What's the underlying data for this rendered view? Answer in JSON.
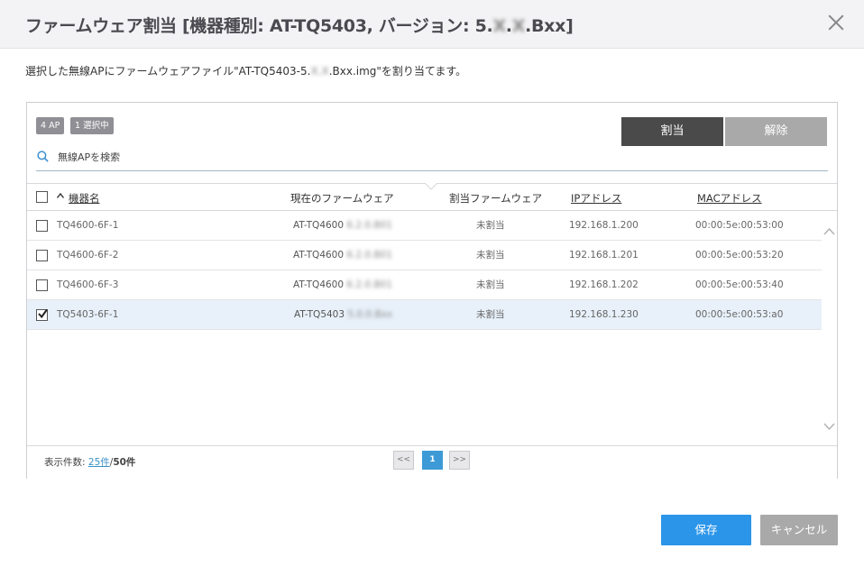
{
  "dialog": {
    "title_prefix": "ファームウェア割当 [機器種別: AT-TQ5403, バージョン: 5.",
    "title_blur1": "X",
    "title_dot": ".",
    "title_blur2": "X",
    "title_suffix": ".Bxx]",
    "close_icon": "close-icon",
    "instruction_prefix": "選択した無線APにファームウェアファイル\"AT-TQ5403-5.",
    "instruction_blur": "X.X",
    "instruction_suffix": ".Bxx.img\"を割り当てます。"
  },
  "toolbar": {
    "badge_ap": "4 AP",
    "badge_selected": "1 選択中",
    "assign_label": "割当",
    "release_label": "解除",
    "search_placeholder": "無線APを検索",
    "search_value": ""
  },
  "table": {
    "columns": {
      "name": "機器名",
      "current_fw": "現在のファームウェア",
      "assigned_fw": "割当ファームウェア",
      "ip": "IPアドレス",
      "mac": "MACアドレス"
    },
    "rows": [
      {
        "name": "TQ4600-6F-1",
        "fw": "AT-TQ4600",
        "fw_ver": "6.2.0.B01",
        "assigned": "未割当",
        "ip": "192.168.1.200",
        "mac": "00:00:5e:00:53:00",
        "checked": false
      },
      {
        "name": "TQ4600-6F-2",
        "fw": "AT-TQ4600",
        "fw_ver": "6.2.0.B01",
        "assigned": "未割当",
        "ip": "192.168.1.201",
        "mac": "00:00:5e:00:53:20",
        "checked": false
      },
      {
        "name": "TQ4600-6F-3",
        "fw": "AT-TQ4600",
        "fw_ver": "6.2.0.B01",
        "assigned": "未割当",
        "ip": "192.168.1.202",
        "mac": "00:00:5e:00:53:40",
        "checked": false
      },
      {
        "name": "TQ5403-6F-1",
        "fw": "AT-TQ5403",
        "fw_ver": "5.0.0.Bxx",
        "assigned": "未割当",
        "ip": "192.168.1.230",
        "mac": "00:00:5e:00:53:a0",
        "checked": true
      }
    ]
  },
  "footer": {
    "count_label": "表示件数: ",
    "count_link": "25件",
    "count_sep": "/",
    "count_total": "50件",
    "prev": "<<",
    "page": "1",
    "next": ">>"
  },
  "actions": {
    "save_label": "保存",
    "cancel_label": "キャンセル"
  },
  "colors": {
    "accent": "#2b95e9",
    "dark_button": "#4a4a4a",
    "disabled_button": "#a9a9a9",
    "selected_row": "#e8f1fa"
  }
}
